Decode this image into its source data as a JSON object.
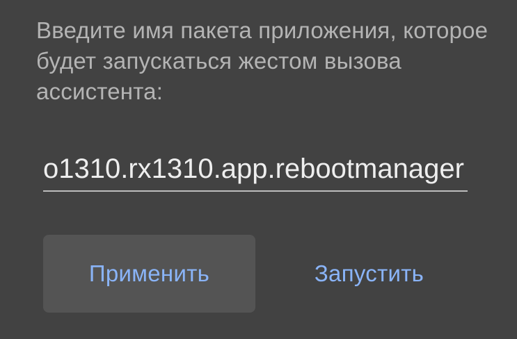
{
  "dialog": {
    "message": "Введите имя пакета приложения, которое будет запускаться жестом вызова ассистента:",
    "package_input": {
      "value": "o1310.rx1310.app.rebootmanager"
    },
    "buttons": {
      "apply_label": "Применить",
      "launch_label": "Запустить"
    }
  },
  "colors": {
    "background": "#424242",
    "message_text": "#b4b4b4",
    "input_text": "#eeeeee",
    "accent": "#8ab4f8",
    "focused_button_bg": "#545454"
  }
}
